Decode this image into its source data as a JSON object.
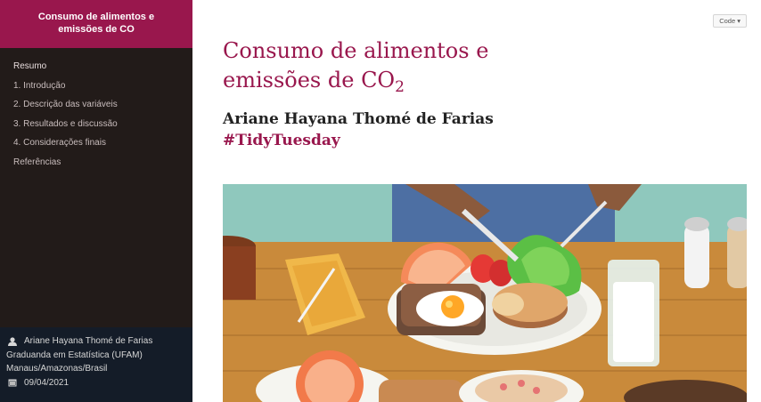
{
  "sidebar": {
    "header_line1": "Consumo de alimentos e",
    "header_line2": "emissões de CO",
    "toc": [
      {
        "label": "Resumo"
      },
      {
        "label": "1. Introdução"
      },
      {
        "label": "2. Descrição das variáveis"
      },
      {
        "label": "3. Resultados e discussão"
      },
      {
        "label": "4. Considerações finais"
      },
      {
        "label": "Referências"
      }
    ],
    "author_box": {
      "name": "Ariane Hayana Thomé de Farias",
      "degree": "Graduanda em Estatística (UFAM)",
      "location": "Manaus/Amazonas/Brasil",
      "date": "09/04/2021",
      "person_icon": "person-icon",
      "calendar_icon": "calendar-icon"
    }
  },
  "main": {
    "code_button": "Code",
    "title_line1": "Consumo de alimentos e",
    "title_line2": "emissões de CO",
    "title_subscript": "2",
    "author": "Ariane Hayana Thomé de Farias",
    "tag": "#TidyTuesday",
    "image_icon": "food-table-illustration"
  },
  "colors": {
    "accent": "#99174d",
    "sidebar_bg": "#221b19",
    "author_box_bg": "#141c28"
  }
}
